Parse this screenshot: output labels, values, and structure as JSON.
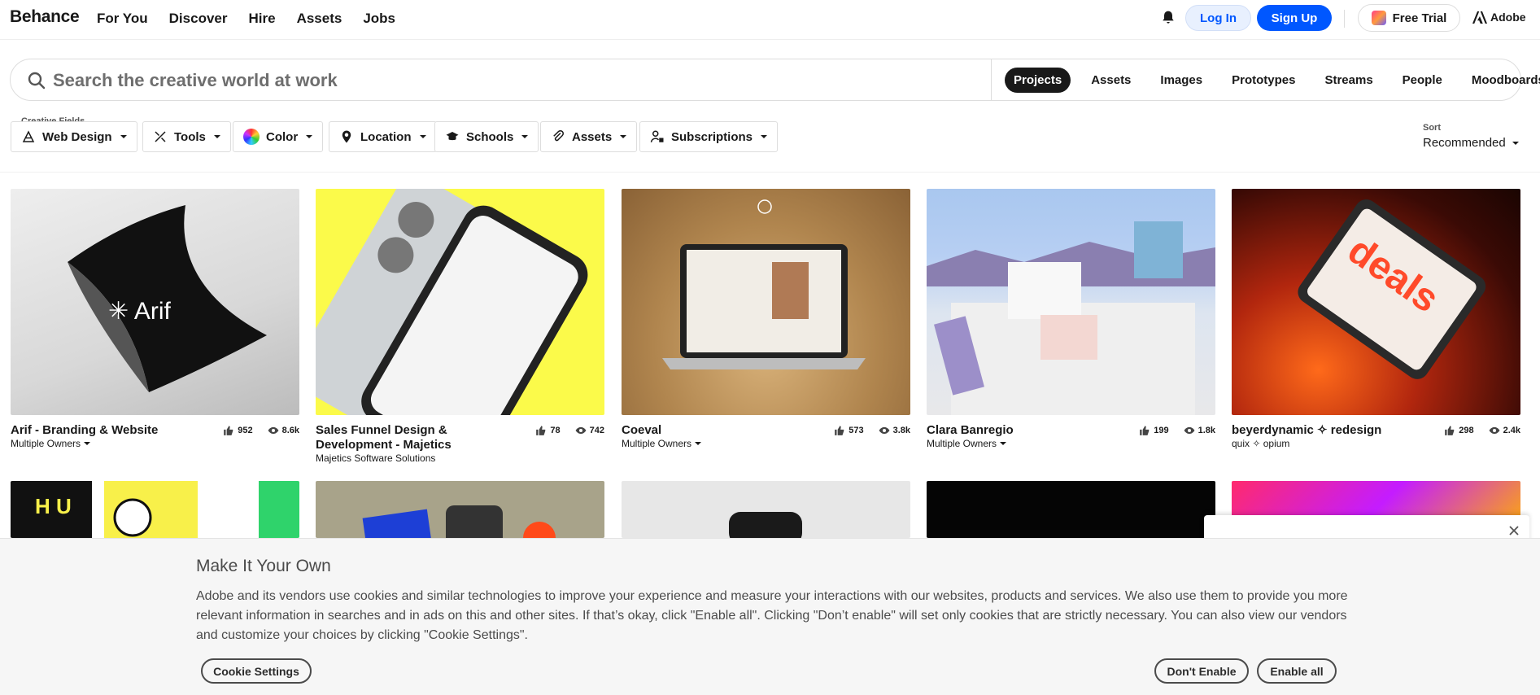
{
  "brand": {
    "logo": "Behance",
    "adobe": "Adobe"
  },
  "nav": {
    "links": [
      "For You",
      "Discover",
      "Hire",
      "Assets",
      "Jobs"
    ]
  },
  "header_actions": {
    "login": "Log In",
    "signup": "Sign Up",
    "trial": "Free Trial"
  },
  "search": {
    "placeholder": "Search the creative world at work",
    "tabs": [
      "Projects",
      "Assets",
      "Images",
      "Prototypes",
      "Streams",
      "People",
      "Moodboards"
    ],
    "active_tab": "Projects"
  },
  "filters": {
    "creative_fields_label": "Creative Fields",
    "items": [
      "Web Design",
      "Tools",
      "Color",
      "Location",
      "Schools",
      "Assets",
      "Subscriptions"
    ],
    "sort_label": "Sort",
    "sort_value": "Recommended"
  },
  "projects": [
    {
      "title": "Arif - Branding & Website",
      "owner": "Multiple Owners",
      "owner_dropdown": true,
      "likes": "952",
      "views": "8.6k"
    },
    {
      "title": "Sales Funnel Design & Development - Majetics",
      "owner": "Majetics Software Solutions",
      "owner_dropdown": false,
      "likes": "78",
      "views": "742"
    },
    {
      "title": "Coeval",
      "owner": "Multiple Owners",
      "owner_dropdown": true,
      "likes": "573",
      "views": "3.8k"
    },
    {
      "title": "Clara Banregio",
      "owner": "Multiple Owners",
      "owner_dropdown": true,
      "likes": "199",
      "views": "1.8k"
    },
    {
      "title": "beyerdynamic ✧ redesign",
      "owner": "quix ✧ opium",
      "owner_dropdown": false,
      "likes": "298",
      "views": "2.4k"
    }
  ],
  "cookie": {
    "title": "Make It Your Own",
    "text": "Adobe and its vendors use cookies and similar technologies to improve your experience and measure your interactions with our websites, products and services. We also use them to provide you more relevant information in searches and in ads on this and other sites. If that’s okay, click \"Enable all\". Clicking \"Don’t enable\" will set only cookies that are strictly necessary. You can also view our vendors and customize your choices by clicking \"Cookie Settings\".",
    "settings": "Cookie Settings",
    "dont_enable": "Don't Enable",
    "enable_all": "Enable all"
  },
  "colors": {
    "accent": "#0057ff",
    "text": "#191919",
    "banner_bg": "#f6f6f6"
  }
}
